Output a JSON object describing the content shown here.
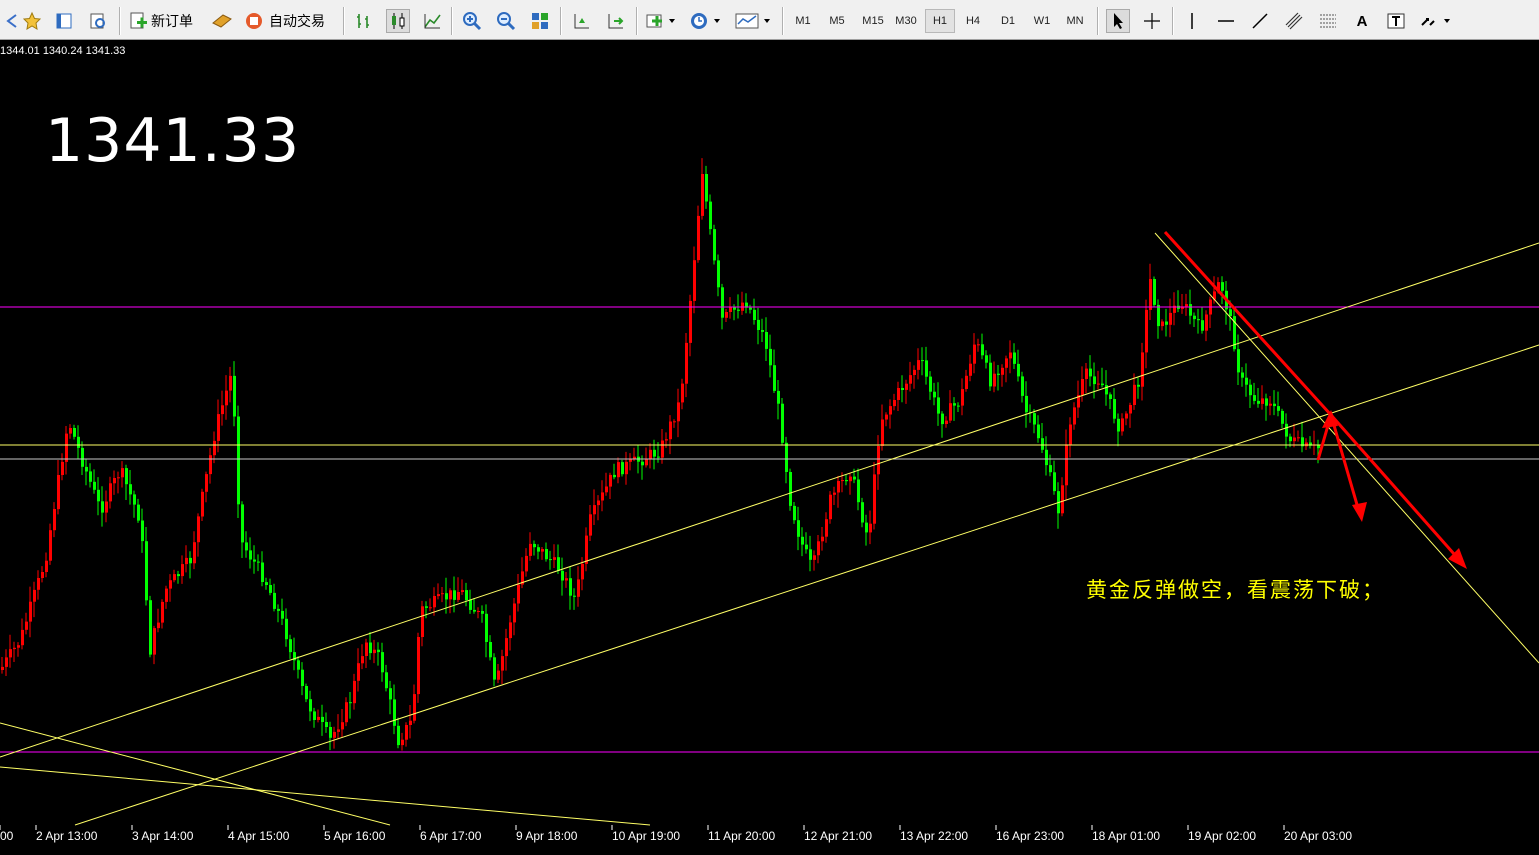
{
  "toolbar": {
    "new_order_label": "新订单",
    "auto_trade_label": "自动交易",
    "timeframes": [
      "M1",
      "M5",
      "M15",
      "M30",
      "H1",
      "H4",
      "D1",
      "W1",
      "MN"
    ],
    "active_timeframe": "H1",
    "text_tool_label": "A"
  },
  "chart": {
    "ohlc_readout": "1344.01 1340.24 1341.33",
    "current_price": "1341.33",
    "annotation": "黄金反弹做空，看震荡下破；",
    "time_labels": [
      "00",
      "2 Apr 13:00",
      "3 Apr 14:00",
      "4 Apr 15:00",
      "5 Apr 16:00",
      "6 Apr 17:00",
      "9 Apr 18:00",
      "10 Apr 19:00",
      "11 Apr 20:00",
      "12 Apr 21:00",
      "13 Apr 22:00",
      "16 Apr 23:00",
      "18 Apr 01:00",
      "19 Apr 02:00",
      "20 Apr 03:00"
    ],
    "colors": {
      "background": "#000000",
      "bull_candle": "#ff0000",
      "bear_candle": "#00ff00",
      "trendline": "#ffff66",
      "level_line": "#ff00ff",
      "arrow": "#ff0000",
      "annotation": "#ffff00"
    }
  }
}
